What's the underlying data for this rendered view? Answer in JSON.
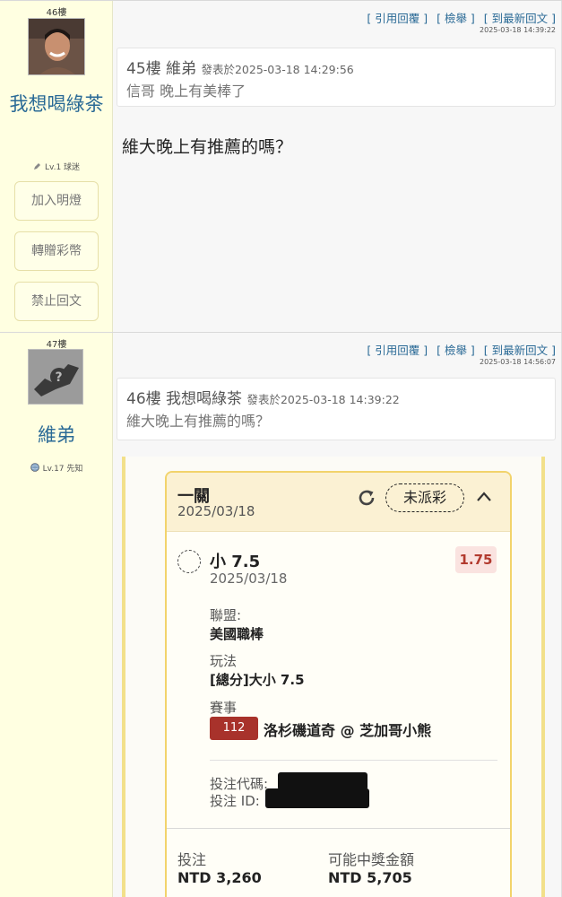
{
  "posts": [
    {
      "floor": "46樓",
      "user": {
        "name": "我想喝綠茶",
        "level": "Lv.1 球迷"
      },
      "side_buttons": [
        "加入明燈",
        "轉贈彩幣",
        "禁止回文"
      ],
      "links": {
        "quote": "[ 引用回覆 ]",
        "report": "[ 檢舉 ]",
        "latest": "[ 到最新回文 ]"
      },
      "timestamp": "2025-03-18 14:39:22",
      "quote": {
        "floor": "45樓",
        "author": "維弟",
        "posted_prefix": "發表於",
        "posted_at": "2025-03-18 14:29:56",
        "text": "信哥 晚上有美棒了"
      },
      "text": "維大晚上有推薦的嗎？"
    },
    {
      "floor": "47樓",
      "user": {
        "name": "維弟",
        "level": "Lv.17 先知"
      },
      "links": {
        "quote": "[ 引用回覆 ]",
        "report": "[ 檢舉 ]",
        "latest": "[ 到最新回文 ]"
      },
      "timestamp": "2025-03-18 14:56:07",
      "quote": {
        "floor": "46樓",
        "author": "我想喝綠茶",
        "posted_prefix": "發表於",
        "posted_at": "2025-03-18 14:39:22",
        "text": "維大晚上有推薦的嗎？"
      },
      "bet_slip": {
        "title": "一關",
        "date": "2025/03/18",
        "status": "未派彩",
        "pick": "小 7.5",
        "pick_date": "2025/03/18",
        "odds": "1.75",
        "league_label": "聯盟:",
        "league": "美國職棒",
        "play_label": "玩法",
        "play": "[總分]大小 7.5",
        "event_label": "賽事",
        "game_no": "112",
        "game": "洛杉磯道奇 @ 芝加哥小熊",
        "code_label": "投注代碼:",
        "id_label": "投注 ID:",
        "stake_label": "投注",
        "stake": "NTD 3,260",
        "payout_label": "可能中獎金額",
        "payout": "NTD 5,705"
      }
    }
  ],
  "colors": {
    "sidebar_bg": "#ffffe1",
    "link": "#2a6a96",
    "status_badge": "#a8322b",
    "odds_text": "#b23a2e"
  }
}
